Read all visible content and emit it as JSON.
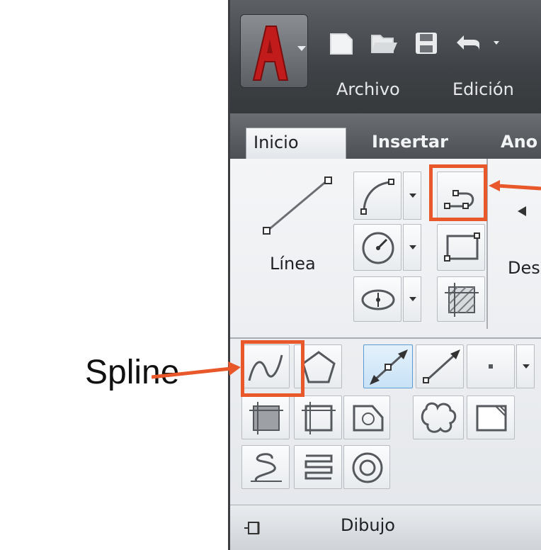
{
  "menu": {
    "archivo": "Archivo",
    "edicion": "Edición"
  },
  "tabs": {
    "inicio": "Inicio",
    "insertar": "Insertar",
    "ano": "Ano"
  },
  "tools": {
    "linea": "Línea",
    "des": "Des"
  },
  "panel": {
    "title": "Dibujo"
  },
  "annotation": {
    "spline_label": "Spline"
  },
  "colors": {
    "highlight": "#e8582a",
    "logo_red": "#c21b1b"
  },
  "icons": [
    "app-logo-icon",
    "new-file-icon",
    "open-folder-icon",
    "save-icon",
    "undo-icon",
    "line-icon",
    "arc-icon",
    "polyline-icon",
    "circle-icon",
    "rectangle-icon",
    "ellipse-icon",
    "hatch-icon",
    "spline-icon",
    "polygon-icon",
    "point-icon",
    "region-icon",
    "revcloud-icon",
    "donut-icon",
    "helix-icon",
    "pin-icon"
  ]
}
